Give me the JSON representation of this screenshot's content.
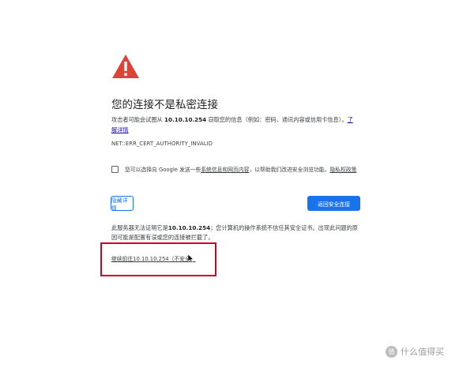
{
  "error_page": {
    "title": "您的连接不是私密连接",
    "explain_prefix": "攻击者可能会试图从 ",
    "host": "10.10.10.254",
    "explain_suffix": " 窃取您的信息（例如：密码、通讯内容或信用卡信息）。",
    "learn_more": "了解详情",
    "error_code": "NET::ERR_CERT_AUTHORITY_INVALID",
    "optin": {
      "checked": false,
      "text_before": "您可以选择向 Google 发送一些",
      "link_system_info": "系统信息和网页内容",
      "text_middle": "，以帮助我们改进安全浏览功能。",
      "link_privacy": "隐私权政策"
    },
    "buttons": {
      "details": "隐藏详情",
      "back_to_safety": "返回安全连接"
    },
    "details": {
      "prefix": "此服务器无法证明它是",
      "host": "10.10.10.254",
      "suffix": "；您计算机的操作系统不信任其安全证书。出现此问题的原因可能是配置有误或您的连接被拦截了。"
    },
    "proceed_link": "继续前往10.10.10.254（不安全）"
  },
  "annotation": {
    "highlight_color": "#d0021b"
  },
  "watermark": {
    "logo": "值",
    "text": "什么值得买"
  },
  "colors": {
    "warning_red": "#db4437",
    "accent_blue": "#1a73e8"
  }
}
